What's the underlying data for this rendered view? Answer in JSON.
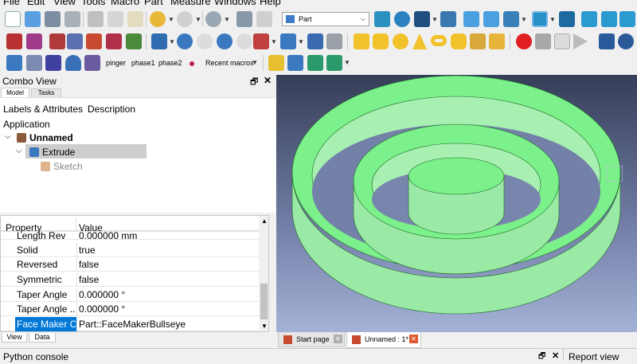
{
  "menu": [
    "File",
    "Edit",
    "View",
    "Tools",
    "Macro",
    "Part",
    "Measure",
    "Windows",
    "Help"
  ],
  "workbench_selector": {
    "value": "Part"
  },
  "macro_bar": {
    "items": [
      "pinger",
      "phase1",
      "phase2"
    ],
    "recent_label": "Recent macros"
  },
  "combo_view": {
    "title": "Combo View",
    "tabs": [
      "Model",
      "Tasks"
    ],
    "tree_headers": [
      "Labels & Attributes",
      "Description"
    ],
    "tree": {
      "root": "Application",
      "document": "Unnamed",
      "feature": "Extrude",
      "child": "Sketch"
    },
    "property_headers": [
      "Property",
      "Value"
    ],
    "properties": [
      {
        "name": "Length Rev",
        "value": "0.000000 mm"
      },
      {
        "name": "Solid",
        "value": "true"
      },
      {
        "name": "Reversed",
        "value": "false"
      },
      {
        "name": "Symmetric",
        "value": "false"
      },
      {
        "name": "Taper Angle",
        "value": "0.000000 °"
      },
      {
        "name": "Taper Angle ...",
        "value": "0.000000 °"
      },
      {
        "name": "Face Maker C...",
        "value": "Part::FaceMakerBullseye"
      }
    ],
    "bottom_tabs": [
      "View",
      "Data"
    ]
  },
  "document_tabs": [
    "Start page",
    "Unnamed : 1*"
  ],
  "python_console": {
    "title": "Python console"
  },
  "report_view": {
    "title": "Report view"
  },
  "colors": {
    "model_green": "#7cf08a",
    "selection_blue": "#0078d7",
    "viewport_top": "#353e57",
    "viewport_bottom": "#a4b2d7"
  }
}
